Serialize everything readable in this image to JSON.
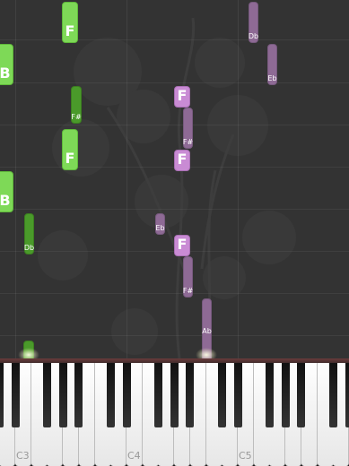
{
  "notes": {
    "f_top": "F",
    "b_upper": "B",
    "f_sharp_1": "F#",
    "f_mid": "F",
    "b_lower": "B",
    "db_left": "Db",
    "db_right": "Db",
    "eb_right": "Eb",
    "f_purple_1": "F",
    "f_sharp_purple_1": "F#",
    "f_purple_2": "F",
    "eb_mid": "Eb",
    "f_purple_3": "F",
    "f_sharp_purple_2": "F#",
    "ab": "Ab"
  },
  "keyboard": {
    "octave_labels": [
      "C3",
      "C4",
      "C5"
    ]
  },
  "colors": {
    "left_hand": "#4a9a2a",
    "left_hand_light": "#7ed957",
    "right_hand": "#8e6a95",
    "right_hand_light": "#c98bd4"
  }
}
